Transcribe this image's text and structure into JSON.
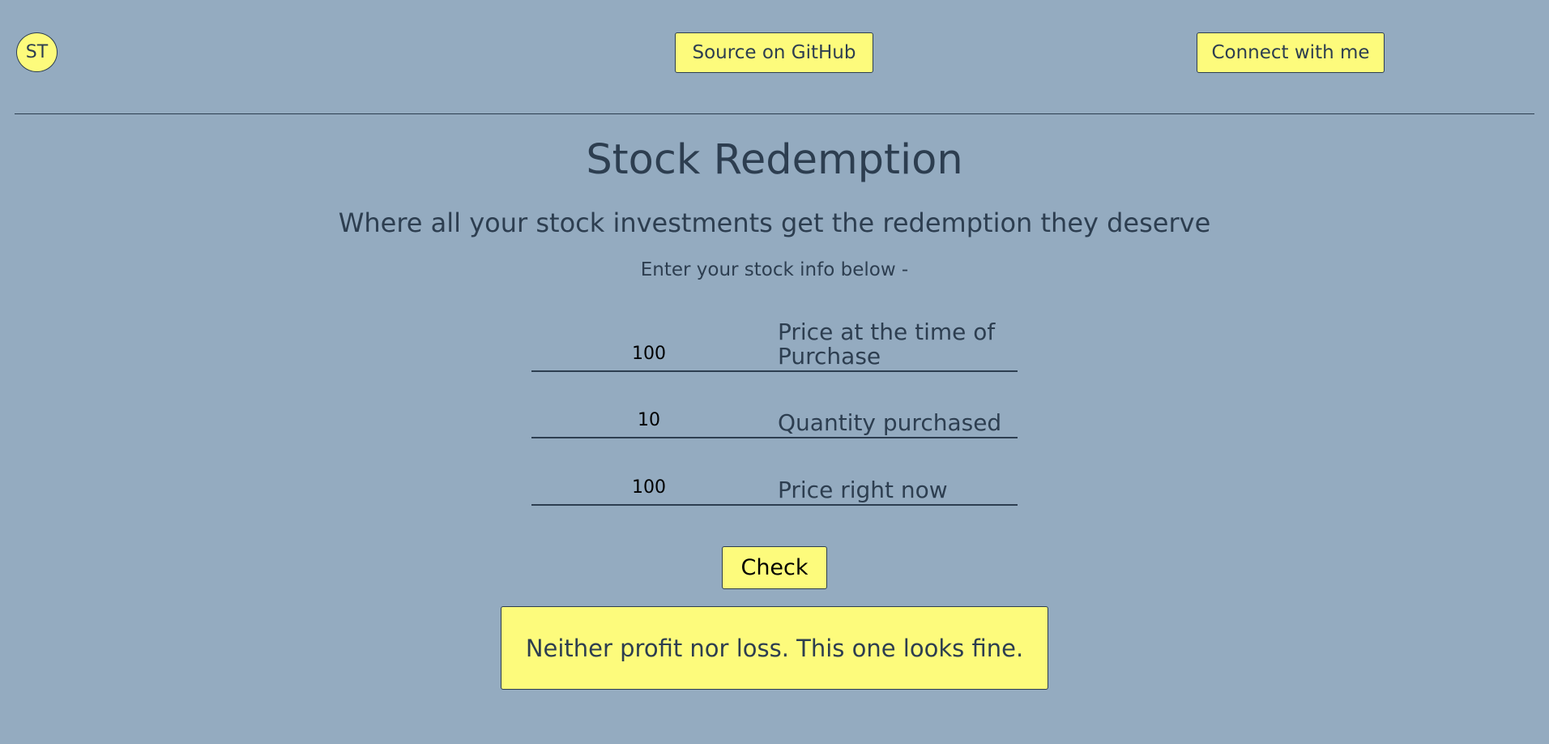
{
  "nav": {
    "avatar_initials": "ST",
    "github_label": "Source on GitHub",
    "connect_label": "Connect with me"
  },
  "header": {
    "title": "Stock Redemption",
    "subtitle": "Where all your stock investments get the redemption they deserve",
    "instruction": "Enter your stock info below -"
  },
  "form": {
    "fields": [
      {
        "value": "100",
        "label": "Price at the time of Purchase"
      },
      {
        "value": "10",
        "label": "Quantity purchased"
      },
      {
        "value": "100",
        "label": "Price right now"
      }
    ],
    "check_label": "Check"
  },
  "result": {
    "message": "Neither profit nor loss. This one looks fine."
  },
  "colors": {
    "background": "#94abc0",
    "accent": "#fdfb7c",
    "text": "#2d3e50"
  }
}
